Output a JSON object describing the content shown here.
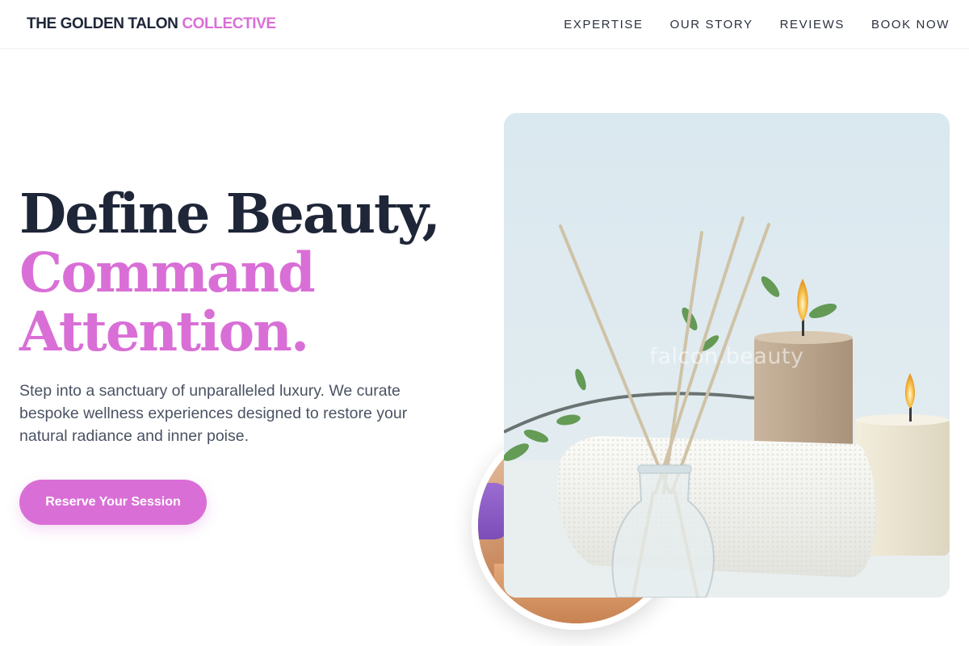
{
  "header": {
    "brand_main": "THE GOLDEN TALON",
    "brand_accent": "COLLECTIVE",
    "nav": [
      "EXPERTISE",
      "OUR STORY",
      "REVIEWS",
      "BOOK NOW"
    ]
  },
  "hero": {
    "headline_line1": "Define Beauty,",
    "headline_line2": "Command",
    "headline_line3": "Attention.",
    "subtitle": "Step into a sanctuary of unparalleled luxury. We curate bespoke wellness experiences designed to restore your natural radiance and inner poise.",
    "cta_label": "Reserve Your Session"
  },
  "media": {
    "watermark": "falcon.beauty"
  },
  "colors": {
    "accent": "#d96fd6",
    "heading": "#1e2638",
    "body_text": "#4a5263"
  }
}
